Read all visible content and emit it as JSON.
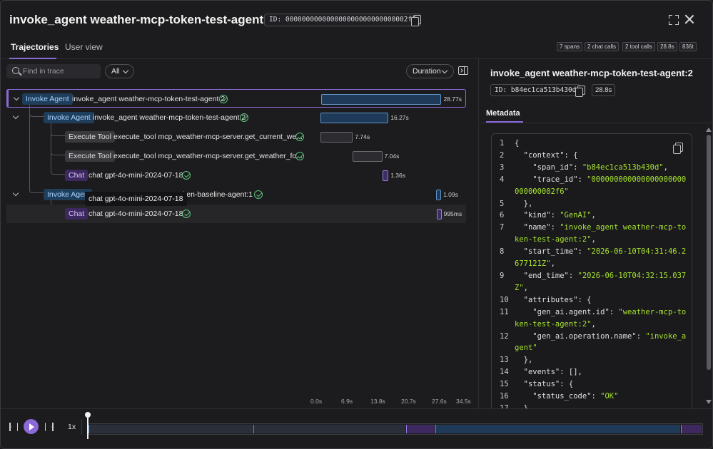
{
  "header": {
    "title": "invoke_agent weather-mcp-token-test-agent:2",
    "trace_id": "ID: 000000000000000000000000000002f6"
  },
  "tabs": [
    {
      "label": "Trajectories",
      "active": true
    },
    {
      "label": "User view",
      "active": false
    }
  ],
  "stats": [
    "7 spans",
    "2 chat calls",
    "2 tool calls",
    "28.8s",
    "836t"
  ],
  "toolbar": {
    "search_placeholder": "Find in trace",
    "filter_value": "All",
    "sort_value": "Duration"
  },
  "spans": [
    {
      "badge": "Invoke Agent",
      "type": "agent",
      "label": "invoke_agent weather-mcp-token-test-agent:2",
      "duration": "28.77s",
      "start_s": 0.0,
      "dur_s": 28.77,
      "depth": 0,
      "expanded": true,
      "selected": true
    },
    {
      "badge": "Invoke Agent",
      "type": "agent",
      "label": "invoke_agent weather-mcp-token-test-agent:2",
      "duration": "16.27s",
      "start_s": 0.0,
      "dur_s": 16.27,
      "depth": 1,
      "expanded": true
    },
    {
      "badge": "Execute Tool",
      "type": "tool",
      "label": "execute_tool mcp_weather-mcp-server.get_current_we...",
      "duration": "7.74s",
      "start_s": 0.0,
      "dur_s": 7.74,
      "depth": 2
    },
    {
      "badge": "Execute Tool",
      "type": "tool",
      "label": "execute_tool mcp_weather-mcp-server.get_weather_fo...",
      "duration": "7.04s",
      "start_s": 7.74,
      "dur_s": 7.04,
      "depth": 2
    },
    {
      "badge": "Chat",
      "type": "chat",
      "label": "chat gpt-4o-mini-2024-07-18",
      "duration": "1.36s",
      "start_s": 14.9,
      "dur_s": 1.36,
      "depth": 2
    },
    {
      "badge": "Invoke Agen",
      "type": "agent",
      "label": "ken-baseline-agent:1",
      "duration": "1.09s",
      "start_s": 27.68,
      "dur_s": 1.09,
      "depth": 1,
      "expanded": true
    },
    {
      "badge": "Chat",
      "type": "chat",
      "label": "chat gpt-4o-mini-2024-07-18",
      "duration": "995ms",
      "start_s": 27.77,
      "dur_s": 0.995,
      "depth": 2,
      "hover": true
    }
  ],
  "tooltip": "chat gpt-4o-mini-2024-07-18",
  "axis": {
    "ticks": [
      "0.0s",
      "6.9s",
      "13.8s",
      "20.7s",
      "27.6s",
      "34.5s"
    ],
    "max_s": 34.5
  },
  "detail": {
    "title": "invoke_agent weather-mcp-token-test-agent:2",
    "span_id": "ID: b84ec1ca513b430d",
    "duration": "28.8s",
    "tab": "Metadata"
  },
  "code_lines": [
    [
      [
        "k",
        "{"
      ]
    ],
    [
      [
        "k",
        "  \"context\": {"
      ]
    ],
    [
      [
        "k",
        "    \"span_id\": "
      ],
      [
        "s",
        "\"b84ec1ca513b430d\""
      ],
      [
        "k",
        ","
      ]
    ],
    [
      [
        "k",
        "    \"trace_id\": "
      ],
      [
        "s",
        "\"000000000000000000000000000002f6\""
      ]
    ],
    [
      [
        "k",
        "  },"
      ]
    ],
    [
      [
        "k",
        "  \"kind\": "
      ],
      [
        "s",
        "\"GenAI\""
      ],
      [
        "k",
        ","
      ]
    ],
    [
      [
        "k",
        "  \"name\": "
      ],
      [
        "s",
        "\"invoke_agent weather-mcp-token-test-agent:2\""
      ],
      [
        "k",
        ","
      ]
    ],
    [
      [
        "k",
        "  \"start_time\": "
      ],
      [
        "s",
        "\"2026-06-10T04:31:46.2677121Z\""
      ],
      [
        "k",
        ","
      ]
    ],
    [
      [
        "k",
        "  \"end_time\": "
      ],
      [
        "s",
        "\"2026-06-10T04:32:15.037Z\""
      ],
      [
        "k",
        ","
      ]
    ],
    [
      [
        "k",
        "  \"attributes\": {"
      ]
    ],
    [
      [
        "k",
        "    \"gen_ai.agent.id\": "
      ],
      [
        "s",
        "\"weather-mcp-token-test-agent:2\""
      ],
      [
        "k",
        ","
      ]
    ],
    [
      [
        "k",
        "    \"gen_ai.operation.name\": "
      ],
      [
        "s",
        "\"invoke_agent\""
      ]
    ],
    [
      [
        "k",
        "  },"
      ]
    ],
    [
      [
        "k",
        "  \"events\": [],"
      ]
    ],
    [
      [
        "k",
        "  \"status\": {"
      ]
    ],
    [
      [
        "k",
        "    \"status_code\": "
      ],
      [
        "s",
        "\"OK\""
      ]
    ],
    [
      [
        "k",
        "  }"
      ]
    ]
  ],
  "playback": {
    "speed": "1x",
    "progress": 0.0
  },
  "colors": {
    "accent": "#8b6ad8",
    "agent": "#5f93c8",
    "chat": "#9b7de4",
    "ok": "#5bc27a",
    "string": "#a6e22e"
  }
}
